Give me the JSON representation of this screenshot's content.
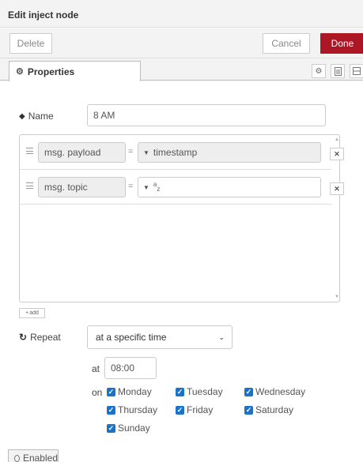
{
  "header": {
    "title": "Edit inject node"
  },
  "toolbar": {
    "delete_label": "Delete",
    "cancel_label": "Cancel",
    "done_label": "Done"
  },
  "tabs": {
    "properties_label": "Properties",
    "icons": [
      "gear-icon",
      "description-icon",
      "appearance-icon"
    ]
  },
  "name_field": {
    "label": "Name",
    "value": "8 AM"
  },
  "properties_list": [
    {
      "target": "msg. payload",
      "operator": "=",
      "value": "timestamp",
      "type": "timestamp"
    },
    {
      "target": "msg. topic",
      "operator": "=",
      "value": "",
      "type": "string",
      "type_glyph": "a",
      "type_glyph_sub": "z"
    }
  ],
  "add_label": "add",
  "repeat": {
    "label": "Repeat",
    "selected": "at a specific time",
    "at_label": "at",
    "time": "08:00",
    "on_label": "on"
  },
  "days": [
    {
      "label": "Monday",
      "checked": true
    },
    {
      "label": "Tuesday",
      "checked": true
    },
    {
      "label": "Wednesday",
      "checked": true
    },
    {
      "label": "Thursday",
      "checked": true
    },
    {
      "label": "Friday",
      "checked": true
    },
    {
      "label": "Saturday",
      "checked": true
    },
    {
      "label": "Sunday",
      "checked": true
    }
  ],
  "footer": {
    "enabled_label": "Enabled"
  },
  "colors": {
    "done_button": "#ad1625",
    "checkbox": "#1a73c8",
    "header_bg": "#f3f3f3"
  }
}
